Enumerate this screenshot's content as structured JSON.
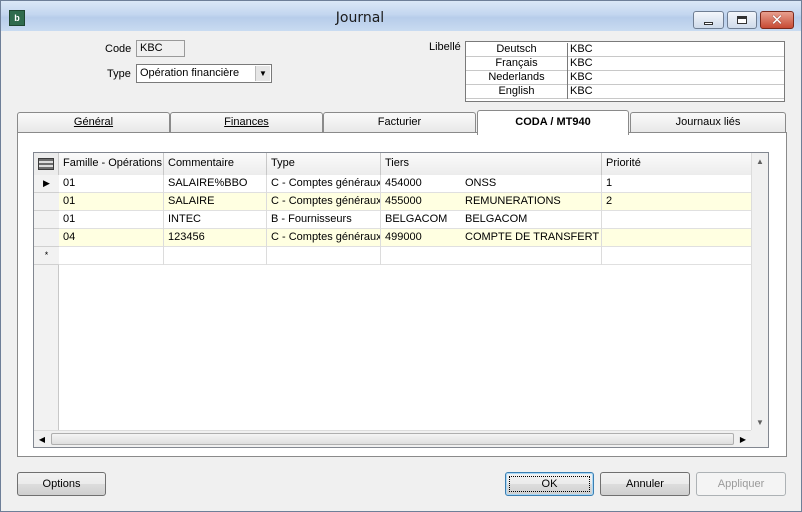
{
  "window": {
    "title": "Journal",
    "app_icon_text": "b"
  },
  "form": {
    "code_label": "Code",
    "code_value": "KBC",
    "type_label": "Type",
    "type_value": "Opération financière",
    "libelle_label": "Libellé",
    "libelle_rows": [
      {
        "lang": "Deutsch",
        "value": "KBC"
      },
      {
        "lang": "Français",
        "value": "KBC"
      },
      {
        "lang": "Nederlands",
        "value": "KBC"
      },
      {
        "lang": "English",
        "value": "KBC"
      }
    ]
  },
  "tabs": [
    {
      "label": "Général",
      "active": false
    },
    {
      "label": "Finances",
      "active": false
    },
    {
      "label": "Facturier",
      "active": false
    },
    {
      "label": "CODA / MT940",
      "active": true
    },
    {
      "label": "Journaux liés",
      "active": false
    }
  ],
  "grid": {
    "columns": [
      "Famille - Opérations",
      "Commentaire",
      "Type",
      "Tiers",
      "Priorité"
    ],
    "rows": [
      {
        "famille": "01",
        "commentaire": "SALAIRE%BBO",
        "type": "C - Comptes généraux",
        "tiers_code": "454000",
        "tiers_name": "ONSS",
        "priorite": "1",
        "current": true
      },
      {
        "famille": "01",
        "commentaire": "SALAIRE",
        "type": "C - Comptes généraux",
        "tiers_code": "455000",
        "tiers_name": "REMUNERATIONS",
        "priorite": "2",
        "current": false
      },
      {
        "famille": "01",
        "commentaire": "INTEC",
        "type": "B - Fournisseurs",
        "tiers_code": "BELGACOM",
        "tiers_name": "BELGACOM",
        "priorite": "",
        "current": false
      },
      {
        "famille": "04",
        "commentaire": "123456",
        "type": "C - Comptes généraux",
        "tiers_code": "499000",
        "tiers_name": "COMPTE DE TRANSFERT",
        "priorite": "",
        "current": false
      }
    ],
    "new_row_marker": "*",
    "current_row_marker": "▶"
  },
  "buttons": {
    "options": "Options",
    "ok": "OK",
    "annuler": "Annuler",
    "appliquer": "Appliquer"
  }
}
